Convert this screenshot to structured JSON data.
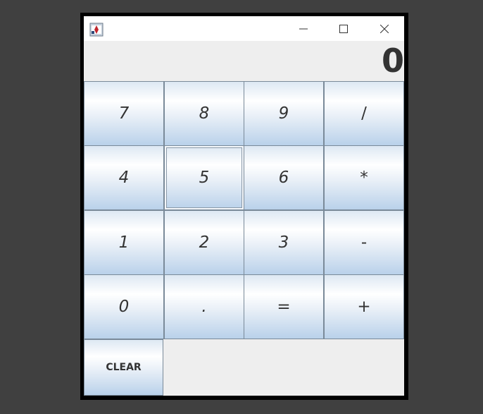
{
  "window": {
    "icon": "java-app-icon",
    "controls": [
      "minimize-icon",
      "maximize-icon",
      "close-icon"
    ]
  },
  "display": {
    "value": "0"
  },
  "keys": {
    "k7": "7",
    "k8": "8",
    "k9": "9",
    "div": "/",
    "k4": "4",
    "k5": "5",
    "k6": "6",
    "mul": "*",
    "k1": "1",
    "k2": "2",
    "k3": "3",
    "sub": "-",
    "k0": "0",
    "dot": ".",
    "eq": "=",
    "add": "+",
    "clear": "CLEAR"
  },
  "colors": {
    "background": "#404040",
    "window_border": "#000000",
    "content_bg": "#eeeeee",
    "key_border": "#7a8a99",
    "key_gradient_bottom": "#b9d1ea",
    "text": "#333333"
  }
}
